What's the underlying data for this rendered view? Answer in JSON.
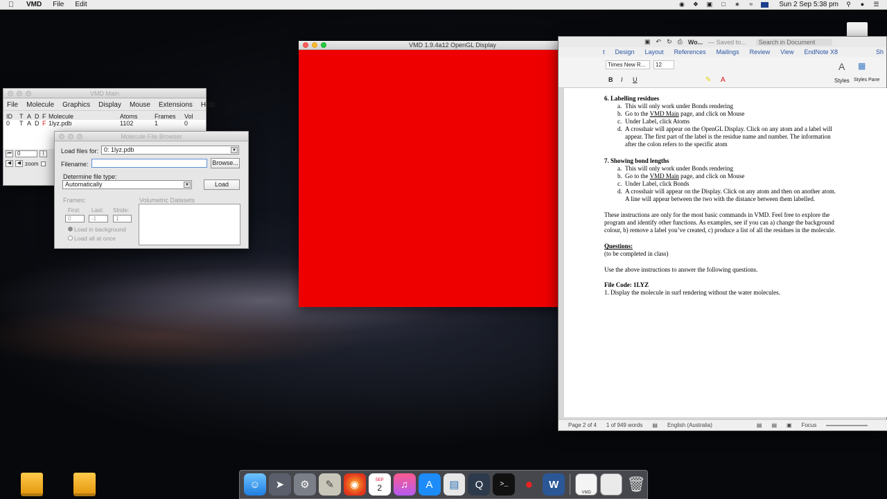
{
  "menubar": {
    "app_name": "VMD",
    "menus": [
      "File",
      "Edit"
    ],
    "clock": "Sun 2 Sep  5:38 pm"
  },
  "vmd_main": {
    "title": "VMD Main",
    "menus": [
      "File",
      "Molecule",
      "Graphics",
      "Display",
      "Mouse",
      "Extensions",
      "Help"
    ],
    "columns": [
      "ID",
      "T",
      "A",
      "D",
      "F",
      "Molecule",
      "Atoms",
      "Frames",
      "Vol"
    ],
    "row": {
      "id": "0",
      "t": "T",
      "a": "A",
      "d": "D",
      "f": "F",
      "molecule": "1lyz.pdb",
      "atoms": "1102",
      "frames": "1",
      "vol": "0"
    },
    "frame_value": "0",
    "zoom_label": "zoom"
  },
  "file_browser": {
    "title": "Molecule File Browser",
    "load_for_label": "Load files for:",
    "load_for_value": "0: 1lyz.pdb",
    "filename_label": "Filename:",
    "filename_value": "",
    "browse_label": "Browse...",
    "filetype_label": "Determine file type:",
    "filetype_value": "Automatically",
    "load_label": "Load",
    "frames_label": "Frames:",
    "first_label": "First:",
    "last_label": "Last:",
    "stride_label": "Stride:",
    "first_value": "0",
    "last_value": "-1",
    "stride_value": "1",
    "load_background": "Load in background",
    "load_all": "Load all at once",
    "volumetric_label": "Volumetric Datasets"
  },
  "gl_display": {
    "title": "VMD 1.9.4a12 OpenGL Display",
    "background_color": "#ee0000"
  },
  "word": {
    "doc_title": "Wo...",
    "saved_status": "— Saved to...",
    "search_placeholder": "Search in Document",
    "tabs": [
      "t",
      "Design",
      "Layout",
      "References",
      "Mailings",
      "Review",
      "View",
      "EndNote X8"
    ],
    "share_label": "Sh",
    "font_name": "Times New R...",
    "font_size": "12",
    "styles_label": "Styles",
    "styles_pane_label": "Styles Pane",
    "content": {
      "h6": "6. Labelling residues",
      "l6a_m": "a.",
      "l6a": "This will only work under Bonds rendering",
      "l6b_m": "b.",
      "l6b_pre": "Go to the ",
      "l6b_link": "VMD Main",
      "l6b_post": " page, and click on Mouse",
      "l6c_m": "c.",
      "l6c": "Under Label, click Atoms",
      "l6d_m": "d.",
      "l6d_1": "A crosshair will appear on the OpenGL Display. Click on any atom and a label will",
      "l6d_2": "appear. The first part of the label is the residue name and number. The information",
      "l6d_3": "after the colon refers to the specific atom",
      "h7": "7. Showing bond lengths",
      "l7a_m": "a.",
      "l7a": "This will only work under Bonds rendering",
      "l7b_m": "b.",
      "l7b_pre": "Go to the ",
      "l7b_link": "VMD Main",
      "l7b_post": " page, and click on Mouse",
      "l7c_m": "c.",
      "l7c": "Under Label, click Bonds",
      "l7d_m": "d.",
      "l7d_1": "A crosshair will appear on the Display. Click on any atom and then on another atom.",
      "l7d_2": "A line will appear between the two with the distance between them labelled.",
      "p1": "These instructions are only for the most basic commands in VMD. Feel free to explore the",
      "p2": "program and identify other functions. As examples, see if you can a) change the background",
      "p3": "colour, b) remove a label you’ve created, c) produce a list of all the residues in the molecule.",
      "questions": "Questions:",
      "to_complete": "(to be completed in class)",
      "use_above": "Use the above instructions to answer the following questions.",
      "file_code": "File Code: 1LYZ",
      "q1": "1. Display the molecule in surf rendering without the water molecules."
    },
    "status_page": "Page 2 of 4",
    "status_words": "1 of 949 words",
    "status_lang": "English (Australia)",
    "status_focus": "Focus"
  },
  "dock": {
    "label_vmd": "VMD",
    "calendar_day": "2",
    "calendar_month": "SEP"
  }
}
